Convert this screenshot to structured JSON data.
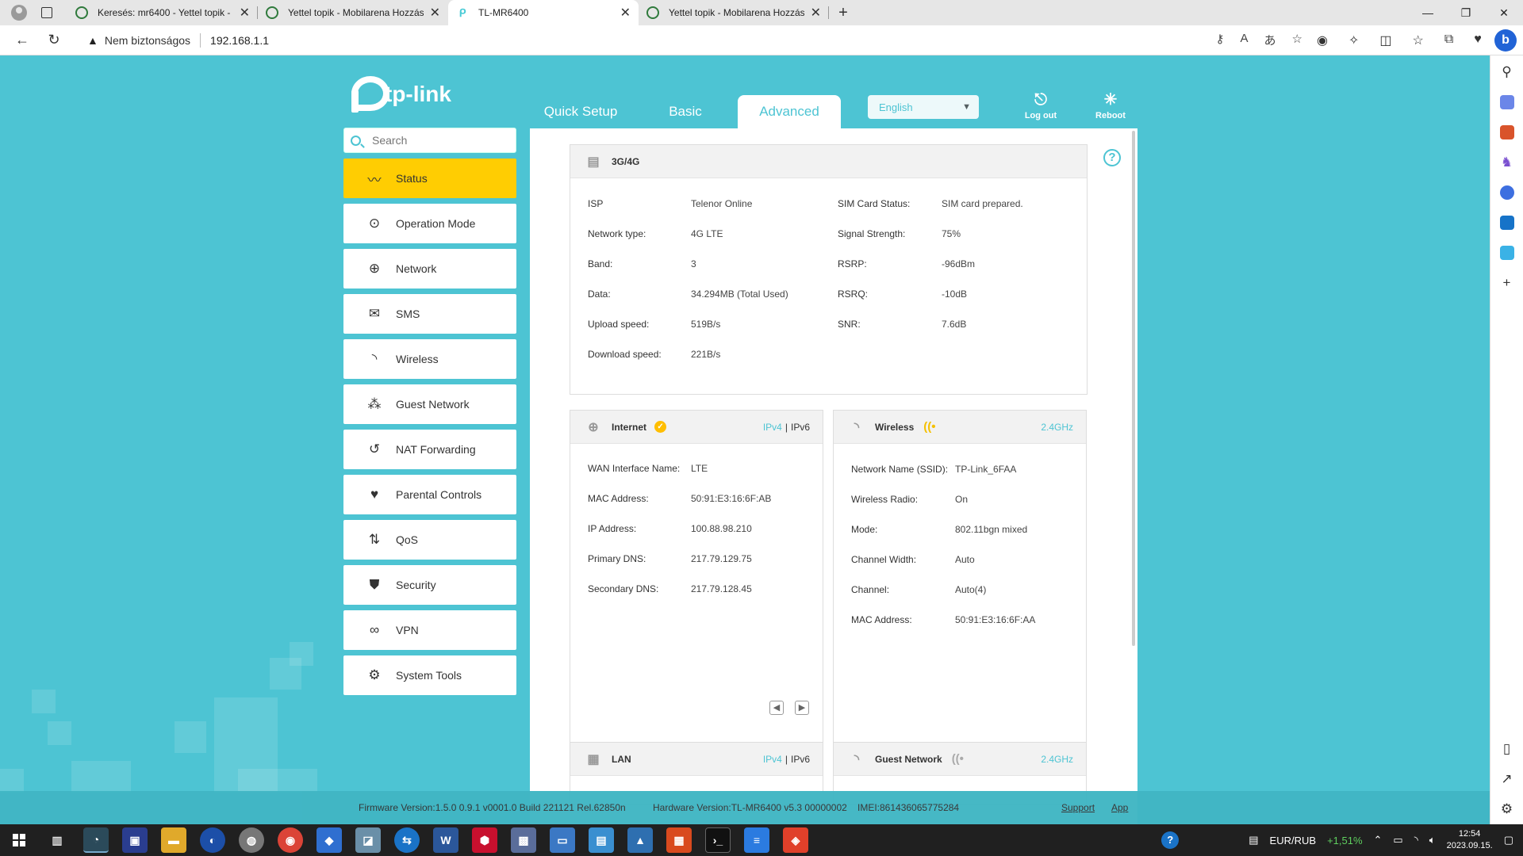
{
  "browser": {
    "tabs": [
      {
        "title": "Keresés: mr6400 - Yettel topik - M",
        "active": false
      },
      {
        "title": "Yettel topik - Mobilarena Hozzász",
        "active": false
      },
      {
        "title": "TL-MR6400",
        "active": true
      },
      {
        "title": "Yettel topik - Mobilarena Hozzász",
        "active": false
      }
    ],
    "security_label": "Nem biztonságos",
    "url": "192.168.1.1"
  },
  "router": {
    "logo": "tp-link",
    "nav": {
      "quick_setup": "Quick Setup",
      "basic": "Basic",
      "advanced": "Advanced"
    },
    "language": "English",
    "logout": "Log out",
    "reboot": "Reboot",
    "search_placeholder": "Search",
    "menu": [
      {
        "label": "Status",
        "icon": "pulse-icon",
        "active": true
      },
      {
        "label": "Operation Mode",
        "icon": "toggle-icon"
      },
      {
        "label": "Network",
        "icon": "globe-icon"
      },
      {
        "label": "SMS",
        "icon": "envelope-icon"
      },
      {
        "label": "Wireless",
        "icon": "wifi-icon"
      },
      {
        "label": "Guest Network",
        "icon": "users-icon"
      },
      {
        "label": "NAT Forwarding",
        "icon": "refresh-icon"
      },
      {
        "label": "Parental Controls",
        "icon": "heart-icon"
      },
      {
        "label": "QoS",
        "icon": "arrows-updown-icon"
      },
      {
        "label": "Security",
        "icon": "shield-icon"
      },
      {
        "label": "VPN",
        "icon": "link-icon"
      },
      {
        "label": "System Tools",
        "icon": "gear-icon"
      }
    ],
    "cellular": {
      "title": "3G/4G",
      "left": [
        {
          "k": "ISP",
          "v": "Telenor Online"
        },
        {
          "k": "Network type:",
          "v": "4G LTE"
        },
        {
          "k": "Band:",
          "v": "3"
        },
        {
          "k": "Data:",
          "v": "34.294MB (Total Used)"
        },
        {
          "k": "Upload speed:",
          "v": "519B/s"
        },
        {
          "k": "Download speed:",
          "v": "221B/s"
        }
      ],
      "right": [
        {
          "k": "SIM Card Status:",
          "v": "SIM card prepared."
        },
        {
          "k": "Signal Strength:",
          "v": "75%"
        },
        {
          "k": "RSRP:",
          "v": "-96dBm"
        },
        {
          "k": "RSRQ:",
          "v": "-10dB"
        },
        {
          "k": "SNR:",
          "v": "7.6dB"
        }
      ]
    },
    "internet": {
      "title": "Internet",
      "ipv4": "IPv4",
      "ipv6": "IPv6",
      "rows": [
        {
          "k": "WAN Interface Name:",
          "v": "LTE"
        },
        {
          "k": "MAC Address:",
          "v": "50:91:E3:16:6F:AB"
        },
        {
          "k": "IP Address:",
          "v": "100.88.98.210"
        },
        {
          "k": "Primary DNS:",
          "v": "217.79.129.75"
        },
        {
          "k": "Secondary DNS:",
          "v": "217.79.128.45"
        }
      ]
    },
    "wireless": {
      "title": "Wireless",
      "band": "2.4GHz",
      "rows": [
        {
          "k": "Network Name (SSID):",
          "v": "TP-Link_6FAA"
        },
        {
          "k": "Wireless Radio:",
          "v": "On"
        },
        {
          "k": "Mode:",
          "v": "802.11bgn mixed"
        },
        {
          "k": "Channel Width:",
          "v": "Auto"
        },
        {
          "k": "Channel:",
          "v": "Auto(4)"
        },
        {
          "k": "MAC Address:",
          "v": "50:91:E3:16:6F:AA"
        }
      ]
    },
    "lan": {
      "title": "LAN",
      "ipv4": "IPv4",
      "ipv6": "IPv6"
    },
    "guest": {
      "title": "Guest Network",
      "band": "2.4GHz"
    },
    "footer": {
      "firmware": "Firmware Version:1.5.0 0.9.1 v0001.0 Build 221121 Rel.62850n",
      "hardware": "Hardware Version:TL-MR6400 v5.3 00000002",
      "imei": "IMEI:861436065775284",
      "support": "Support",
      "app": "App"
    }
  },
  "taskbar": {
    "currency": "EUR/RUB",
    "change": "+1,51%",
    "time": "12:54",
    "date": "2023.09.15."
  }
}
